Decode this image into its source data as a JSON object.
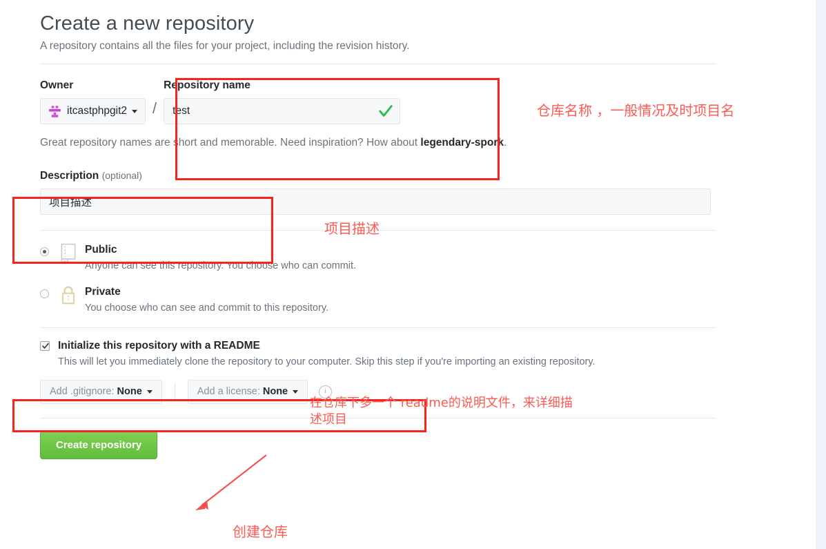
{
  "form": {
    "title": "Create a new repository",
    "subtitle": "A repository contains all the files for your project, including the revision history.",
    "owner_label": "Owner",
    "owner_value": "itcastphpgit2",
    "separator": "/",
    "repo_label": "Repository name",
    "repo_value": "test",
    "repo_placeholder": "",
    "hint_prefix": "Great repository names are short and memorable. Need inspiration? How about ",
    "hint_suggestion": "legendary-spork",
    "hint_suffix": ".",
    "description_label": "Description",
    "description_optional": "(optional)",
    "description_value": "项目描述",
    "description_placeholder": ""
  },
  "visibility": {
    "public": {
      "name": "Public",
      "desc": "Anyone can see this repository. You choose who can commit.",
      "selected": true,
      "icon": "book-icon"
    },
    "private": {
      "name": "Private",
      "desc": "You choose who can see and commit to this repository.",
      "selected": false,
      "icon": "lock-icon"
    }
  },
  "readme": {
    "label": "Initialize this repository with a README",
    "desc": "This will let you immediately clone the repository to your computer. Skip this step if you're importing an existing repository.",
    "checked": true
  },
  "selects": {
    "gitignore_prefix": "Add .gitignore:",
    "gitignore_value": "None",
    "license_prefix": "Add a license:",
    "license_value": "None",
    "info_glyph": "i"
  },
  "submit": {
    "label": "Create repository",
    "color": "#6cc644"
  },
  "annotations": {
    "color": "#fd5a52",
    "box_color": "#f8231c",
    "repo_name_note": "仓库名称 ，一般情况及时项目名",
    "description_note": "项目描述",
    "readme_note": "在仓库下多一个  readme的说明文件，来详细描\n述项目",
    "create_note": "创建仓库"
  }
}
